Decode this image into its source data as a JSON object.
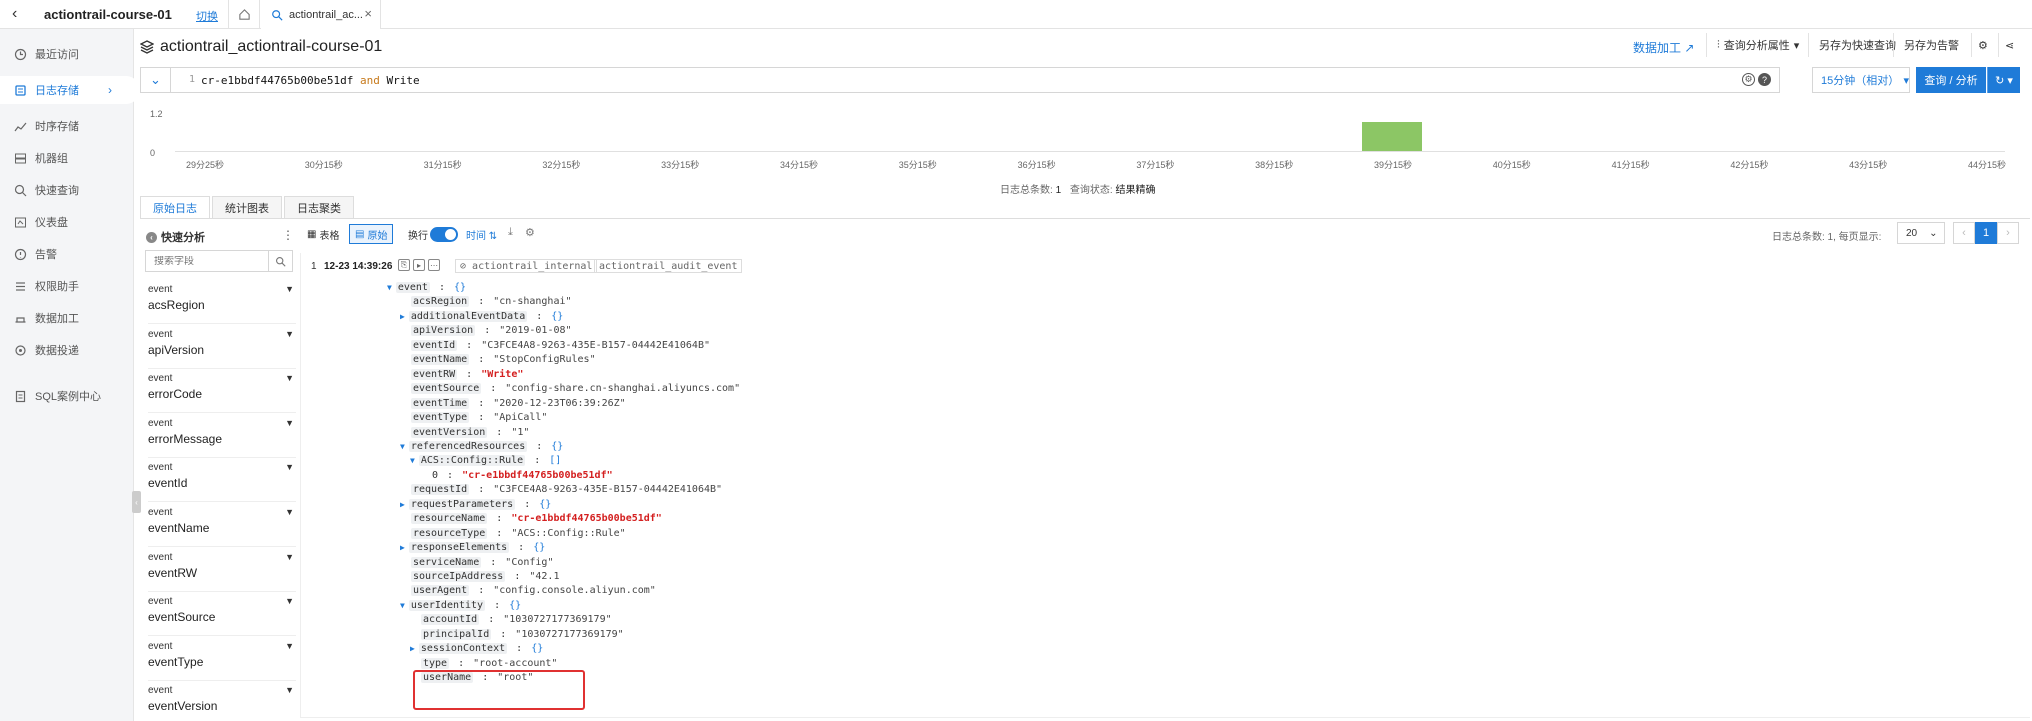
{
  "topbar": {
    "project": "actiontrail-course-01",
    "switch_label": "切换",
    "tab_label": "actiontrail_ac..."
  },
  "sidebar": {
    "items": [
      {
        "label": "最近访问",
        "icon": "clock-icon"
      },
      {
        "label": "日志存储",
        "icon": "log-storage-icon",
        "active": true
      },
      {
        "label": "时序存储",
        "icon": "chart-line-icon"
      },
      {
        "label": "机器组",
        "icon": "server-icon"
      },
      {
        "label": "快速查询",
        "icon": "search-icon"
      },
      {
        "label": "仪表盘",
        "icon": "dashboard-icon"
      },
      {
        "label": "告警",
        "icon": "bell-icon"
      },
      {
        "label": "权限助手",
        "icon": "list-icon"
      },
      {
        "label": "数据加工",
        "icon": "process-icon"
      },
      {
        "label": "数据投递",
        "icon": "delivery-icon"
      },
      {
        "label": "SQL案例中心",
        "icon": "document-icon"
      }
    ]
  },
  "header": {
    "title": "actiontrail_actiontrail-course-01",
    "data_process": "数据加工",
    "analysis_attr": "查询分析属性",
    "save_quick": "另存为快速查询",
    "save_alert": "另存为告警"
  },
  "query": {
    "line_no": "1",
    "text_part1": "cr-e1bbdf44765b00be51df",
    "keyword": "and",
    "text_part2": "Write",
    "time_range": "15分钟（相对）",
    "search_label": "查询 / 分析"
  },
  "chart_data": {
    "type": "bar",
    "title": "",
    "ylim": [
      0,
      1.2
    ],
    "yticks": [
      "1.2",
      "0"
    ],
    "x_ticks": [
      "29分25秒",
      "30分15秒",
      "31分15秒",
      "32分15秒",
      "33分15秒",
      "34分15秒",
      "35分15秒",
      "36分15秒",
      "37分15秒",
      "38分15秒",
      "39分15秒",
      "40分15秒",
      "41分15秒",
      "42分15秒",
      "43分15秒",
      "44分15秒"
    ],
    "bars": [
      {
        "x_index": 10,
        "value": 1
      }
    ],
    "grid": false,
    "color": "#8cc665"
  },
  "status": {
    "total_label": "日志总条数:",
    "total": "1",
    "state_label": "查询状态:",
    "state": "结果精确"
  },
  "subtabs": [
    "原始日志",
    "统计图表",
    "日志聚类"
  ],
  "fields": {
    "title": "快速分析",
    "search_placeholder": "搜索字段",
    "items": [
      {
        "group": "event",
        "name": "acsRegion"
      },
      {
        "group": "event",
        "name": "apiVersion"
      },
      {
        "group": "event",
        "name": "errorCode"
      },
      {
        "group": "event",
        "name": "errorMessage"
      },
      {
        "group": "event",
        "name": "eventId"
      },
      {
        "group": "event",
        "name": "eventName"
      },
      {
        "group": "event",
        "name": "eventRW"
      },
      {
        "group": "event",
        "name": "eventSource"
      },
      {
        "group": "event",
        "name": "eventType"
      },
      {
        "group": "event",
        "name": "eventVersion"
      }
    ]
  },
  "logtoolbar": {
    "table": "表格",
    "raw": "原始",
    "wrap": "换行",
    "time": "时间",
    "pager_label": "日志总条数: 1, 每页显示:",
    "page_size": "20",
    "page": "1"
  },
  "log": {
    "index": "1",
    "time": "12-23 14:39:26",
    "tags": [
      "actiontrail_internal",
      "actiontrail_audit_event"
    ],
    "lines": [
      {
        "k": "event",
        "v": "{}",
        "indent": 0,
        "arrow": "down"
      },
      {
        "k": "acsRegion",
        "v": "\"cn-shanghai\"",
        "indent": 1
      },
      {
        "k": "additionalEventData",
        "v": "{}",
        "indent": 1,
        "arrow": "right"
      },
      {
        "k": "apiVersion",
        "v": "\"2019-01-08\"",
        "indent": 1
      },
      {
        "k": "eventId",
        "v": "\"C3FCE4A8-9263-435E-B157-04442E41064B\"",
        "indent": 1
      },
      {
        "k": "eventName",
        "v": "\"StopConfigRules\"",
        "indent": 1
      },
      {
        "k": "eventRW",
        "v": "\"Write\"",
        "indent": 1,
        "red": true
      },
      {
        "k": "eventSource",
        "v": "\"config-share.cn-shanghai.aliyuncs.com\"",
        "indent": 1
      },
      {
        "k": "eventTime",
        "v": "\"2020-12-23T06:39:26Z\"",
        "indent": 1
      },
      {
        "k": "eventType",
        "v": "\"ApiCall\"",
        "indent": 1
      },
      {
        "k": "eventVersion",
        "v": "\"1\"",
        "indent": 1
      },
      {
        "k": "referencedResources",
        "v": "{}",
        "indent": 1,
        "arrow": "down"
      },
      {
        "k": "ACS::Config::Rule",
        "v": "[]",
        "indent": 2,
        "arrow": "down"
      },
      {
        "k": "0",
        "v": "\"cr-e1bbdf44765b00be51df\"",
        "indent": 3,
        "red": true,
        "plain": true
      },
      {
        "k": "requestId",
        "v": "\"C3FCE4A8-9263-435E-B157-04442E41064B\"",
        "indent": 1
      },
      {
        "k": "requestParameters",
        "v": "{}",
        "indent": 1,
        "arrow": "right"
      },
      {
        "k": "resourceName",
        "v": "\"cr-e1bbdf44765b00be51df\"",
        "indent": 1,
        "red": true
      },
      {
        "k": "resourceType",
        "v": "\"ACS::Config::Rule\"",
        "indent": 1
      },
      {
        "k": "responseElements",
        "v": "{}",
        "indent": 1,
        "arrow": "right"
      },
      {
        "k": "serviceName",
        "v": "\"Config\"",
        "indent": 1
      },
      {
        "k": "sourceIpAddress",
        "v": "\"42.1",
        "indent": 1
      },
      {
        "k": "userAgent",
        "v": "\"config.console.aliyun.com\"",
        "indent": 1
      },
      {
        "k": "userIdentity",
        "v": "{}",
        "indent": 1,
        "arrow": "down"
      },
      {
        "k": "accountId",
        "v": "\"1030727177369179\"",
        "indent": 2
      },
      {
        "k": "principalId",
        "v": "\"1030727177369179\"",
        "indent": 2
      },
      {
        "k": "sessionContext",
        "v": "{}",
        "indent": 2,
        "arrow": "right"
      },
      {
        "k": "type",
        "v": "\"root-account\"",
        "indent": 2
      },
      {
        "k": "userName",
        "v": "\"root\"",
        "indent": 2
      }
    ]
  }
}
